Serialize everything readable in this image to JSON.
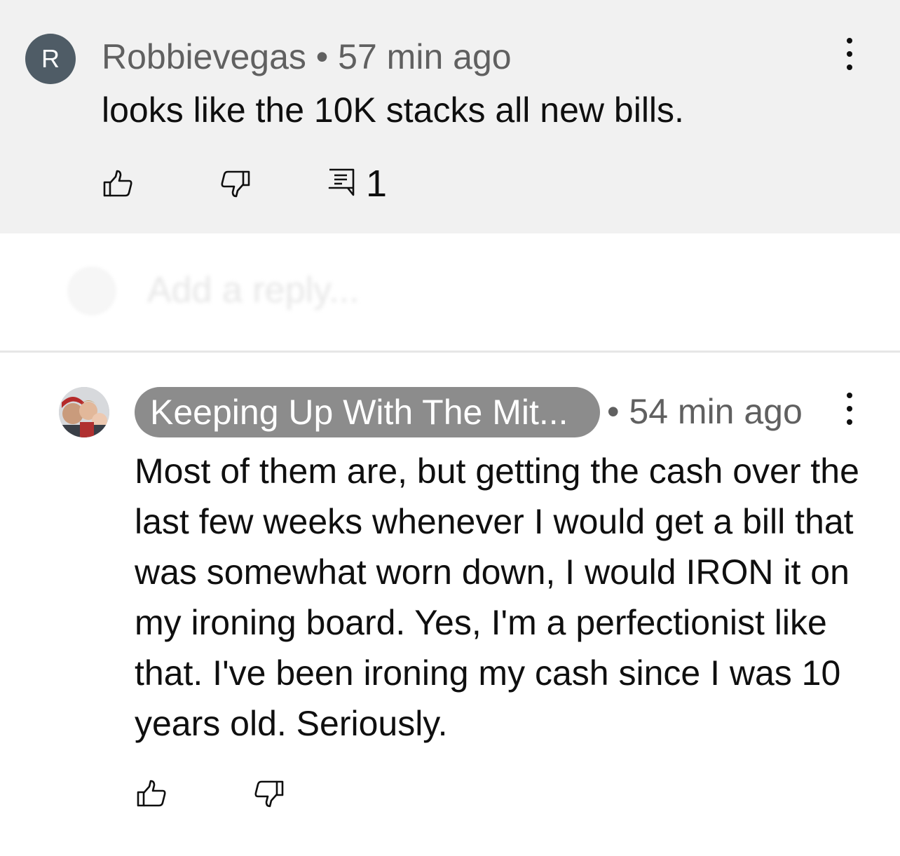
{
  "top_comment": {
    "avatar_letter": "R",
    "author": "Robbievegas",
    "separator": " • ",
    "time": "57 min ago",
    "text": "looks like the 10K stacks all new bills.",
    "reply_count": "1",
    "icons": [
      "like-icon",
      "dislike-icon",
      "reply-icon",
      "more-vert-icon"
    ],
    "background": "#f1f1f1"
  },
  "add_reply": {
    "placeholder": "Add a reply..."
  },
  "reply": {
    "author": "Keeping Up With The Mit...",
    "separator": "• ",
    "time": "54 min ago",
    "text": "Most of them are, but getting the cash over the last few weeks whenever I would get a bill that was somewhat worn down, I would IRON it on my ironing board. Yes, I'm a perfectionist like that. I've been ironing my cash since I was 10 years old. Seriously.",
    "author_chip_color": "#8c8c8c",
    "icons": [
      "like-icon",
      "dislike-icon",
      "more-vert-icon"
    ]
  }
}
